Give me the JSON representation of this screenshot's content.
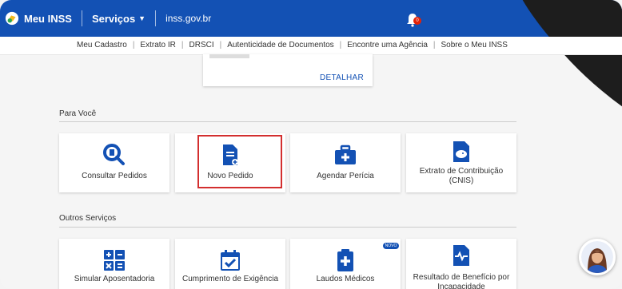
{
  "header": {
    "app_title": "Meu INSS",
    "services_label": "Serviços",
    "site": "inss.gov.br",
    "notification_count": "0",
    "colors": {
      "primary": "#1351b4",
      "alert": "#e52207",
      "highlight": "#d32f2f"
    }
  },
  "subnav": {
    "items": [
      {
        "label": "Meu Cadastro"
      },
      {
        "label": "Extrato IR"
      },
      {
        "label": "DRSCI"
      },
      {
        "label": "Autenticidade de Documentos"
      },
      {
        "label": "Encontre uma Agência"
      },
      {
        "label": "Sobre o Meu INSS"
      }
    ]
  },
  "detail_card": {
    "button_label": "DETALHAR"
  },
  "para_voce": {
    "title": "Para Você",
    "cards": [
      {
        "label": "Consultar Pedidos",
        "icon": "search-document-icon"
      },
      {
        "label": "Novo Pedido",
        "icon": "new-document-icon"
      },
      {
        "label": "Agendar Perícia",
        "icon": "medical-case-icon"
      },
      {
        "label": "Extrato de Contribuição (CNIS)",
        "icon": "piggy-bank-document-icon"
      }
    ]
  },
  "outros_servicos": {
    "title": "Outros Serviços",
    "new_badge": "NOVO",
    "cards": [
      {
        "label": "Simular Aposentadoria",
        "icon": "calculator-icon"
      },
      {
        "label": "Cumprimento de Exigência",
        "icon": "calendar-check-icon"
      },
      {
        "label": "Laudos Médicos",
        "icon": "medical-report-icon"
      },
      {
        "label": "Resultado de Benefício por Incapacidade",
        "icon": "heartbeat-document-icon"
      }
    ]
  }
}
